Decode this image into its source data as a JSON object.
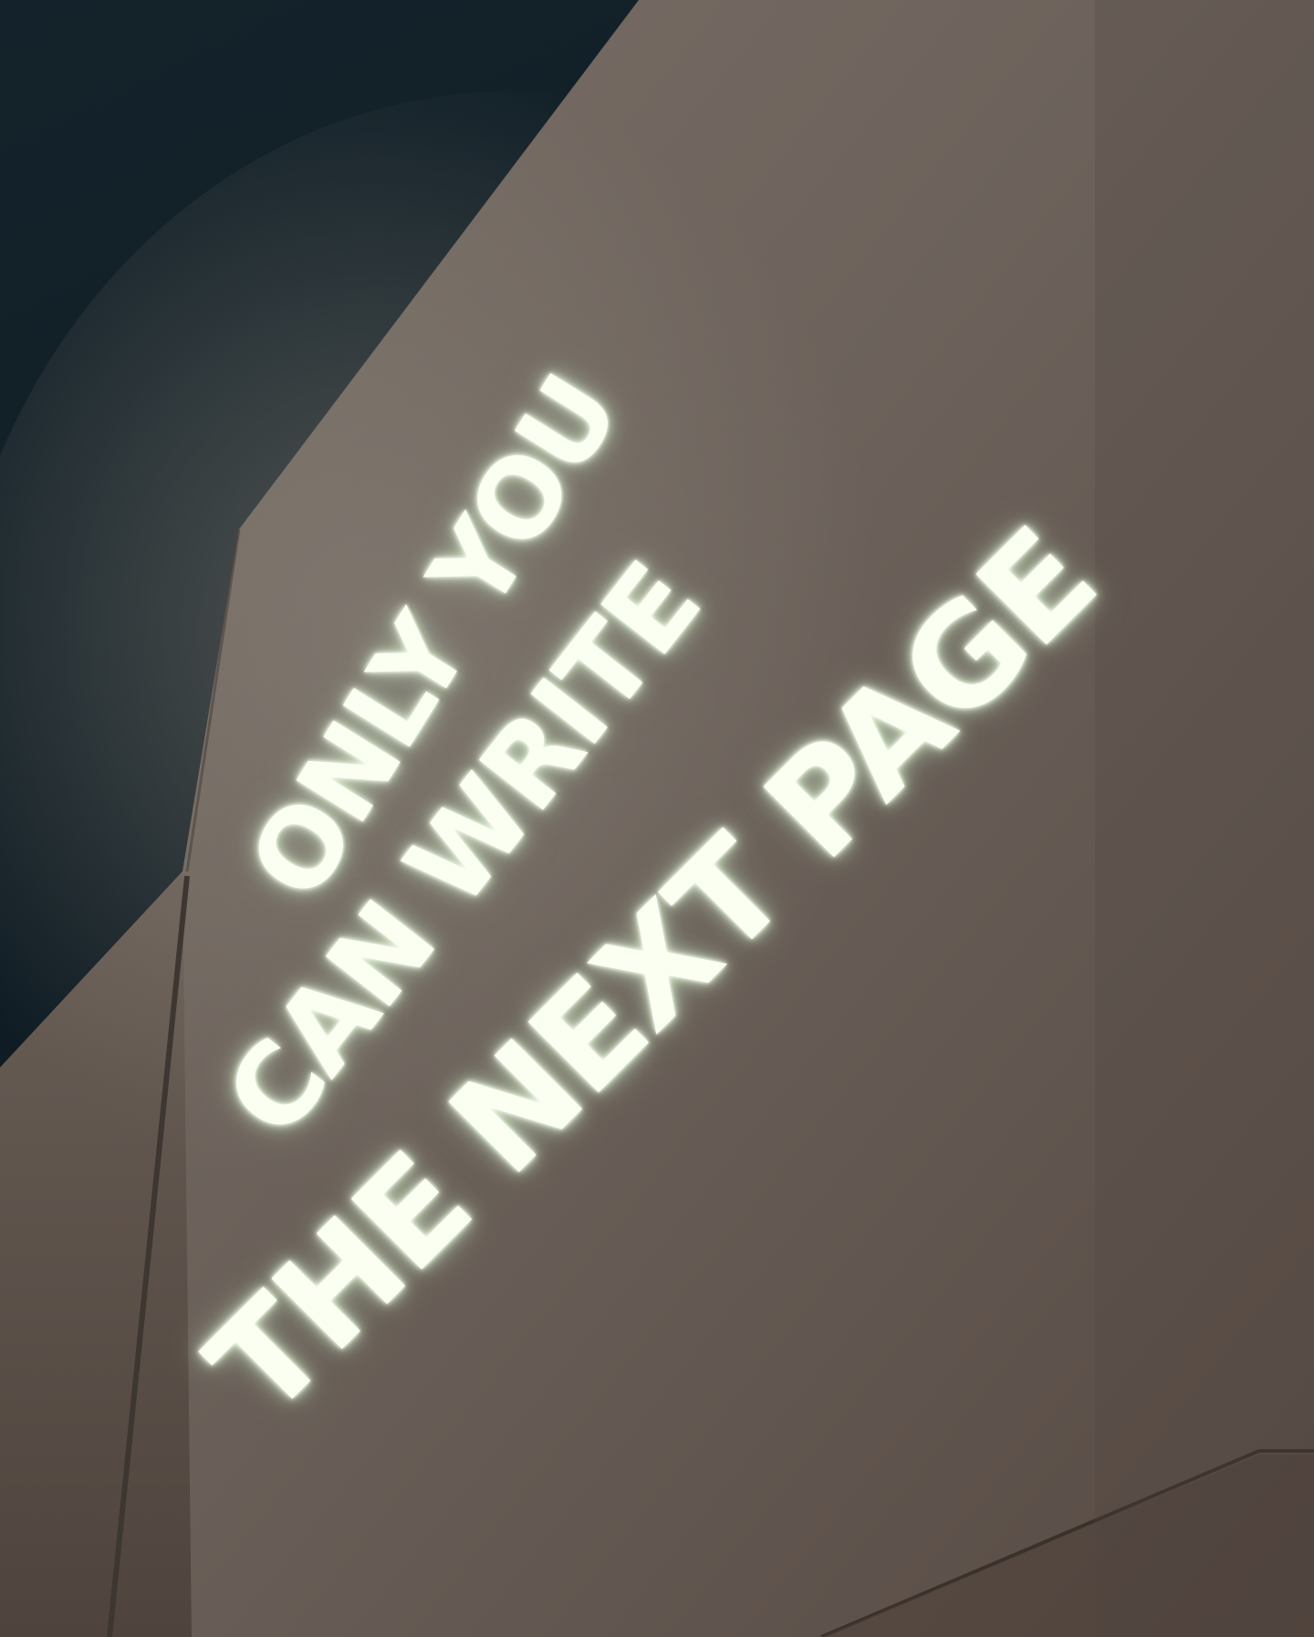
{
  "sign": {
    "line_1": "ONLY YOU",
    "line_2": "CAN WRITE",
    "line_3": "THE NEXT PAGE"
  },
  "colors": {
    "night_sky": "#0f1c24",
    "wall": "#6e645c",
    "wall_shadow": "#5a5049",
    "sign_light": "#fbfff2"
  }
}
